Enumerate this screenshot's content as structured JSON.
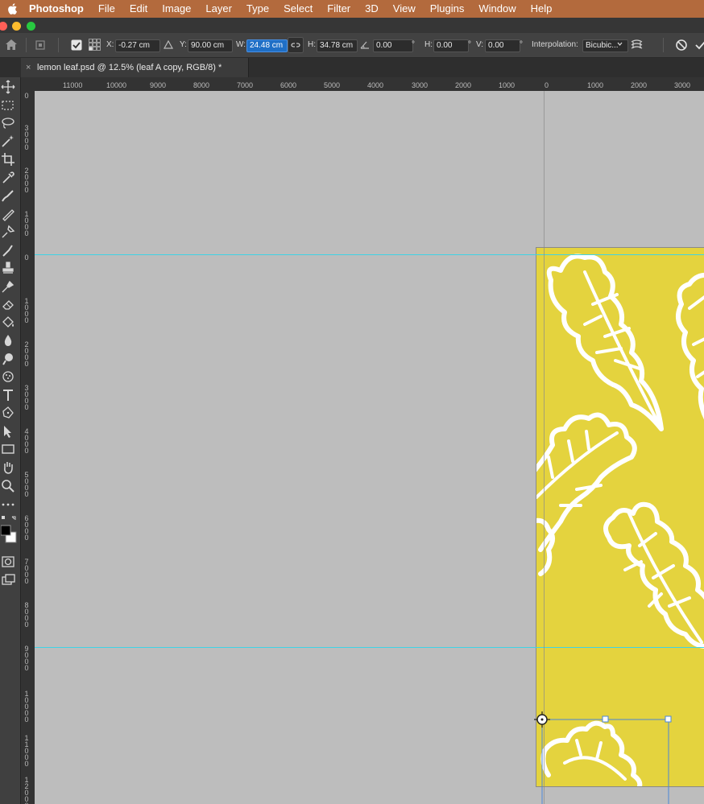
{
  "menubar": {
    "app": "Photoshop",
    "items": [
      "File",
      "Edit",
      "Image",
      "Layer",
      "Type",
      "Select",
      "Filter",
      "3D",
      "View",
      "Plugins",
      "Window",
      "Help"
    ]
  },
  "options": {
    "x_label": "X:",
    "x_value": "-0.27 cm",
    "y_label": "Y:",
    "y_value": "90.00 cm",
    "w_label": "W:",
    "w_value": "24.48 cm",
    "h_label": "H:",
    "h_value": "34.78 cm",
    "angle_value": "0.00",
    "skew_h_label": "H:",
    "skew_h_value": "0.00",
    "skew_v_label": "V:",
    "skew_v_value": "0.00",
    "degree": "°",
    "interp_label": "Interpolation:",
    "interp_value": "Bicubic..."
  },
  "document_tab": {
    "close": "×",
    "title": "lemon leaf.psd @ 12.5% (leaf A copy, RGB/8) *"
  },
  "hruler": [
    "11000",
    "10000",
    "9000",
    "8000",
    "7000",
    "6000",
    "5000",
    "4000",
    "3000",
    "2000",
    "1000",
    "0",
    "1000",
    "2000",
    "3000"
  ],
  "vruler": [
    "0",
    "3000",
    "2000",
    "1000",
    "0",
    "1000",
    "2000",
    "3000",
    "4000",
    "5000",
    "6000",
    "7000",
    "8000",
    "9000",
    "10000",
    "11000",
    "12000"
  ],
  "colors": {
    "menubar": "#b36a3d",
    "document_fill": "#e4d33e",
    "guide": "#3fd3e6",
    "selection": "#1f6fc6"
  }
}
